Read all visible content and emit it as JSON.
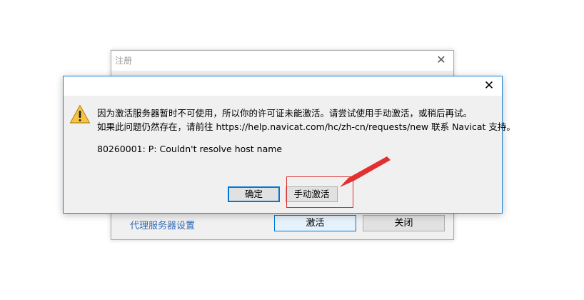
{
  "registration_window": {
    "title": "注册",
    "close_glyph": "✕",
    "proxy_link": "代理服务器设置",
    "activate_button": "激活",
    "close_button": "关闭"
  },
  "error_dialog": {
    "close_glyph": "✕",
    "icon": "warning-icon",
    "message_line_1": "因为激活服务器暂时不可使用，所以你的许可证未能激活。请尝试使用手动激活，或稍后再试。",
    "message_line_2": "如果此问题仍然存在，请前往 https://help.navicat.com/hc/zh-cn/requests/new 联系 Navicat 支持。",
    "error_code": "80260001: P: Couldn't resolve host name",
    "ok_button": "确定",
    "manual_activation_button": "手动激活"
  },
  "annotation": {
    "color": "#e03030"
  }
}
